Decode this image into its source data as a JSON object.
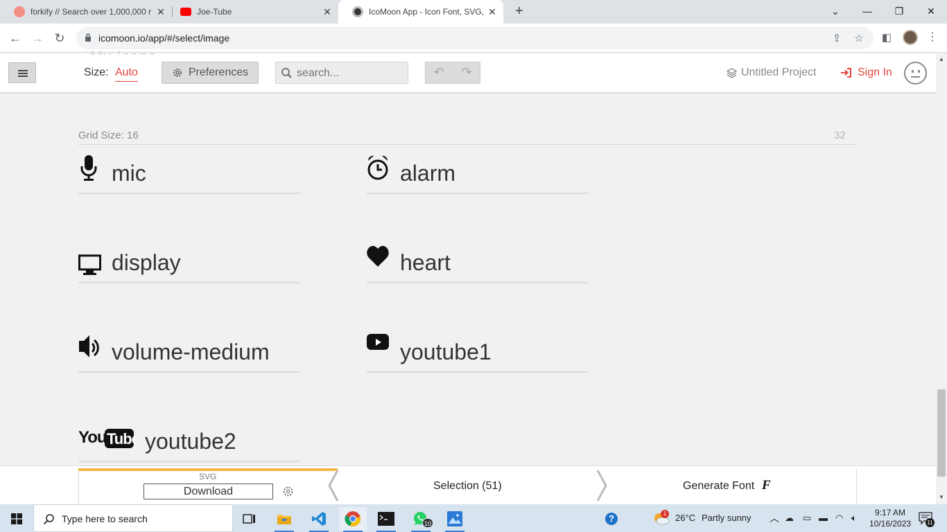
{
  "browser": {
    "tabs": [
      {
        "title": "forkify // Search over 1,000,000 r",
        "active": false
      },
      {
        "title": "Joe-Tube",
        "active": false
      },
      {
        "title": "IcoMoon App - Icon Font, SVG, I",
        "active": true
      }
    ],
    "url": "icomoon.io/app/#/select/image"
  },
  "app": {
    "ghost_title": "My Icons",
    "size_label": "Size:",
    "size_value": "Auto",
    "preferences_label": "Preferences",
    "search_placeholder": "search...",
    "project_label": "Untitled Project",
    "signin_label": "Sign In"
  },
  "grid": {
    "label": "Grid Size: 16",
    "right_value": "32"
  },
  "glyphs": [
    {
      "name": "mic",
      "icon": "mic-icon"
    },
    {
      "name": "alarm",
      "icon": "alarm-icon"
    },
    {
      "name": "display",
      "icon": "display-icon"
    },
    {
      "name": "heart",
      "icon": "heart-icon"
    },
    {
      "name": "volume-medium",
      "icon": "volume-medium-icon"
    },
    {
      "name": "youtube1",
      "icon": "youtube-icon"
    },
    {
      "name": "youtube2",
      "icon": "youtube-logo-icon"
    }
  ],
  "bottom": {
    "svg_label": "SVG",
    "download_label": "Download",
    "selection_label": "Selection (51)",
    "generate_label": "Generate Font",
    "generate_glyph": "F"
  },
  "taskbar": {
    "search_placeholder": "Type here to search",
    "whatsapp_badge": "10",
    "weather_badge": "1",
    "temperature": "26°C",
    "weather": "Partly sunny",
    "time": "9:17 AM",
    "date": "10/16/2023",
    "notification_count": "11"
  },
  "colors": {
    "accent_red": "#e5453d",
    "progress_yellow": "#f2b84b"
  }
}
